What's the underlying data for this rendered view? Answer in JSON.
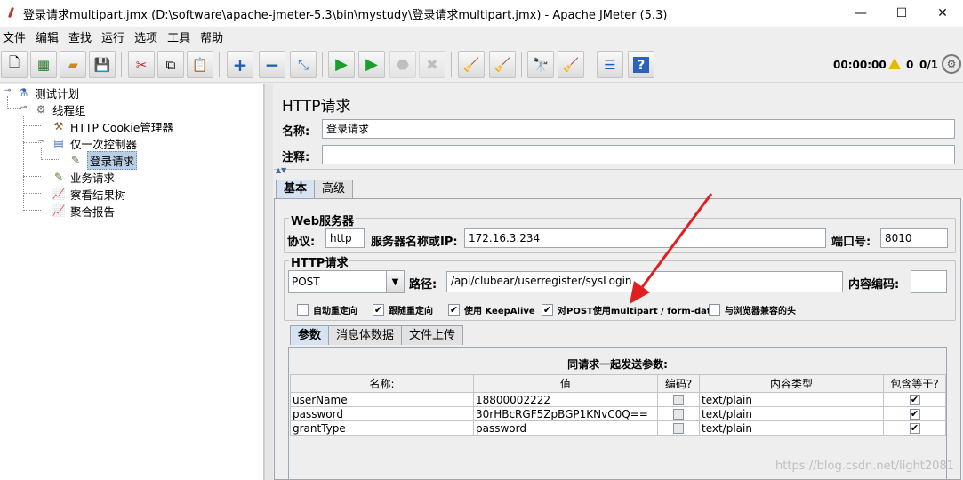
{
  "window": {
    "title": "登录请求multipart.jmx (D:\\software\\apache-jmeter-5.3\\bin\\mystudy\\登录请求multipart.jmx) - Apache JMeter (5.3)",
    "minimize": "—",
    "maximize": "☐",
    "close": "✕"
  },
  "menu": [
    "文件",
    "编辑",
    "查找",
    "运行",
    "选项",
    "工具",
    "帮助"
  ],
  "toolbar": {
    "timer": "00:00:00",
    "warnings": "0",
    "threads": "0/1"
  },
  "tree": {
    "nodes": [
      {
        "label": "测试计划",
        "icon": "test-plan-icon"
      },
      {
        "label": "线程组",
        "icon": "gear-icon"
      },
      {
        "label": "HTTP Cookie管理器",
        "icon": "tools-icon"
      },
      {
        "label": "仅一次控制器",
        "icon": "controller-icon"
      },
      {
        "label": "登录请求",
        "icon": "sampler-icon"
      },
      {
        "label": "业务请求",
        "icon": "sampler-icon"
      },
      {
        "label": "察看结果树",
        "icon": "listener-icon"
      },
      {
        "label": "聚合报告",
        "icon": "listener-icon"
      }
    ]
  },
  "panel": {
    "title": "HTTP请求",
    "name_label": "名称:",
    "name_value": "登录请求",
    "comment_label": "注释:",
    "comment_value": "",
    "tabs": [
      "基本",
      "高级"
    ]
  },
  "web_server": {
    "group_title": "Web服务器",
    "protocol_label": "协议:",
    "protocol_value": "http",
    "server_label": "服务器名称或IP:",
    "server_value": "172.16.3.234",
    "port_label": "端口号:",
    "port_value": "8010"
  },
  "http_request": {
    "group_title": "HTTP请求",
    "method": "POST",
    "path_label": "路径:",
    "path_value": "/api/clubear/userregister/sysLogin",
    "encoding_label": "内容编码:",
    "encoding_value": "",
    "options": [
      {
        "label": "自动重定向",
        "checked": false
      },
      {
        "label": "跟随重定向",
        "checked": true
      },
      {
        "label": "使用 KeepAlive",
        "checked": true
      },
      {
        "label": "对POST使用multipart / form-data",
        "checked": true
      },
      {
        "label": "与浏览器兼容的头",
        "checked": false
      }
    ]
  },
  "sub_tabs": [
    "参数",
    "消息体数据",
    "文件上传"
  ],
  "params": {
    "caption": "同请求一起发送参数:",
    "headers": [
      "名称:",
      "值",
      "编码?",
      "内容类型",
      "包含等于?"
    ],
    "rows": [
      {
        "name": "userName",
        "value": "18800002222",
        "encode": false,
        "content_type": "text/plain",
        "include_equals": true
      },
      {
        "name": "password",
        "value": "30rHBcRGF5ZpBGP1KNvC0Q==",
        "encode": false,
        "content_type": "text/plain",
        "include_equals": true
      },
      {
        "name": "grantType",
        "value": "password",
        "encode": false,
        "content_type": "text/plain",
        "include_equals": true
      }
    ]
  },
  "watermark": "https://blog.csdn.net/light2081",
  "colors": {
    "annotation_arrow": "#e02020",
    "selection": "#b8cfe5"
  }
}
